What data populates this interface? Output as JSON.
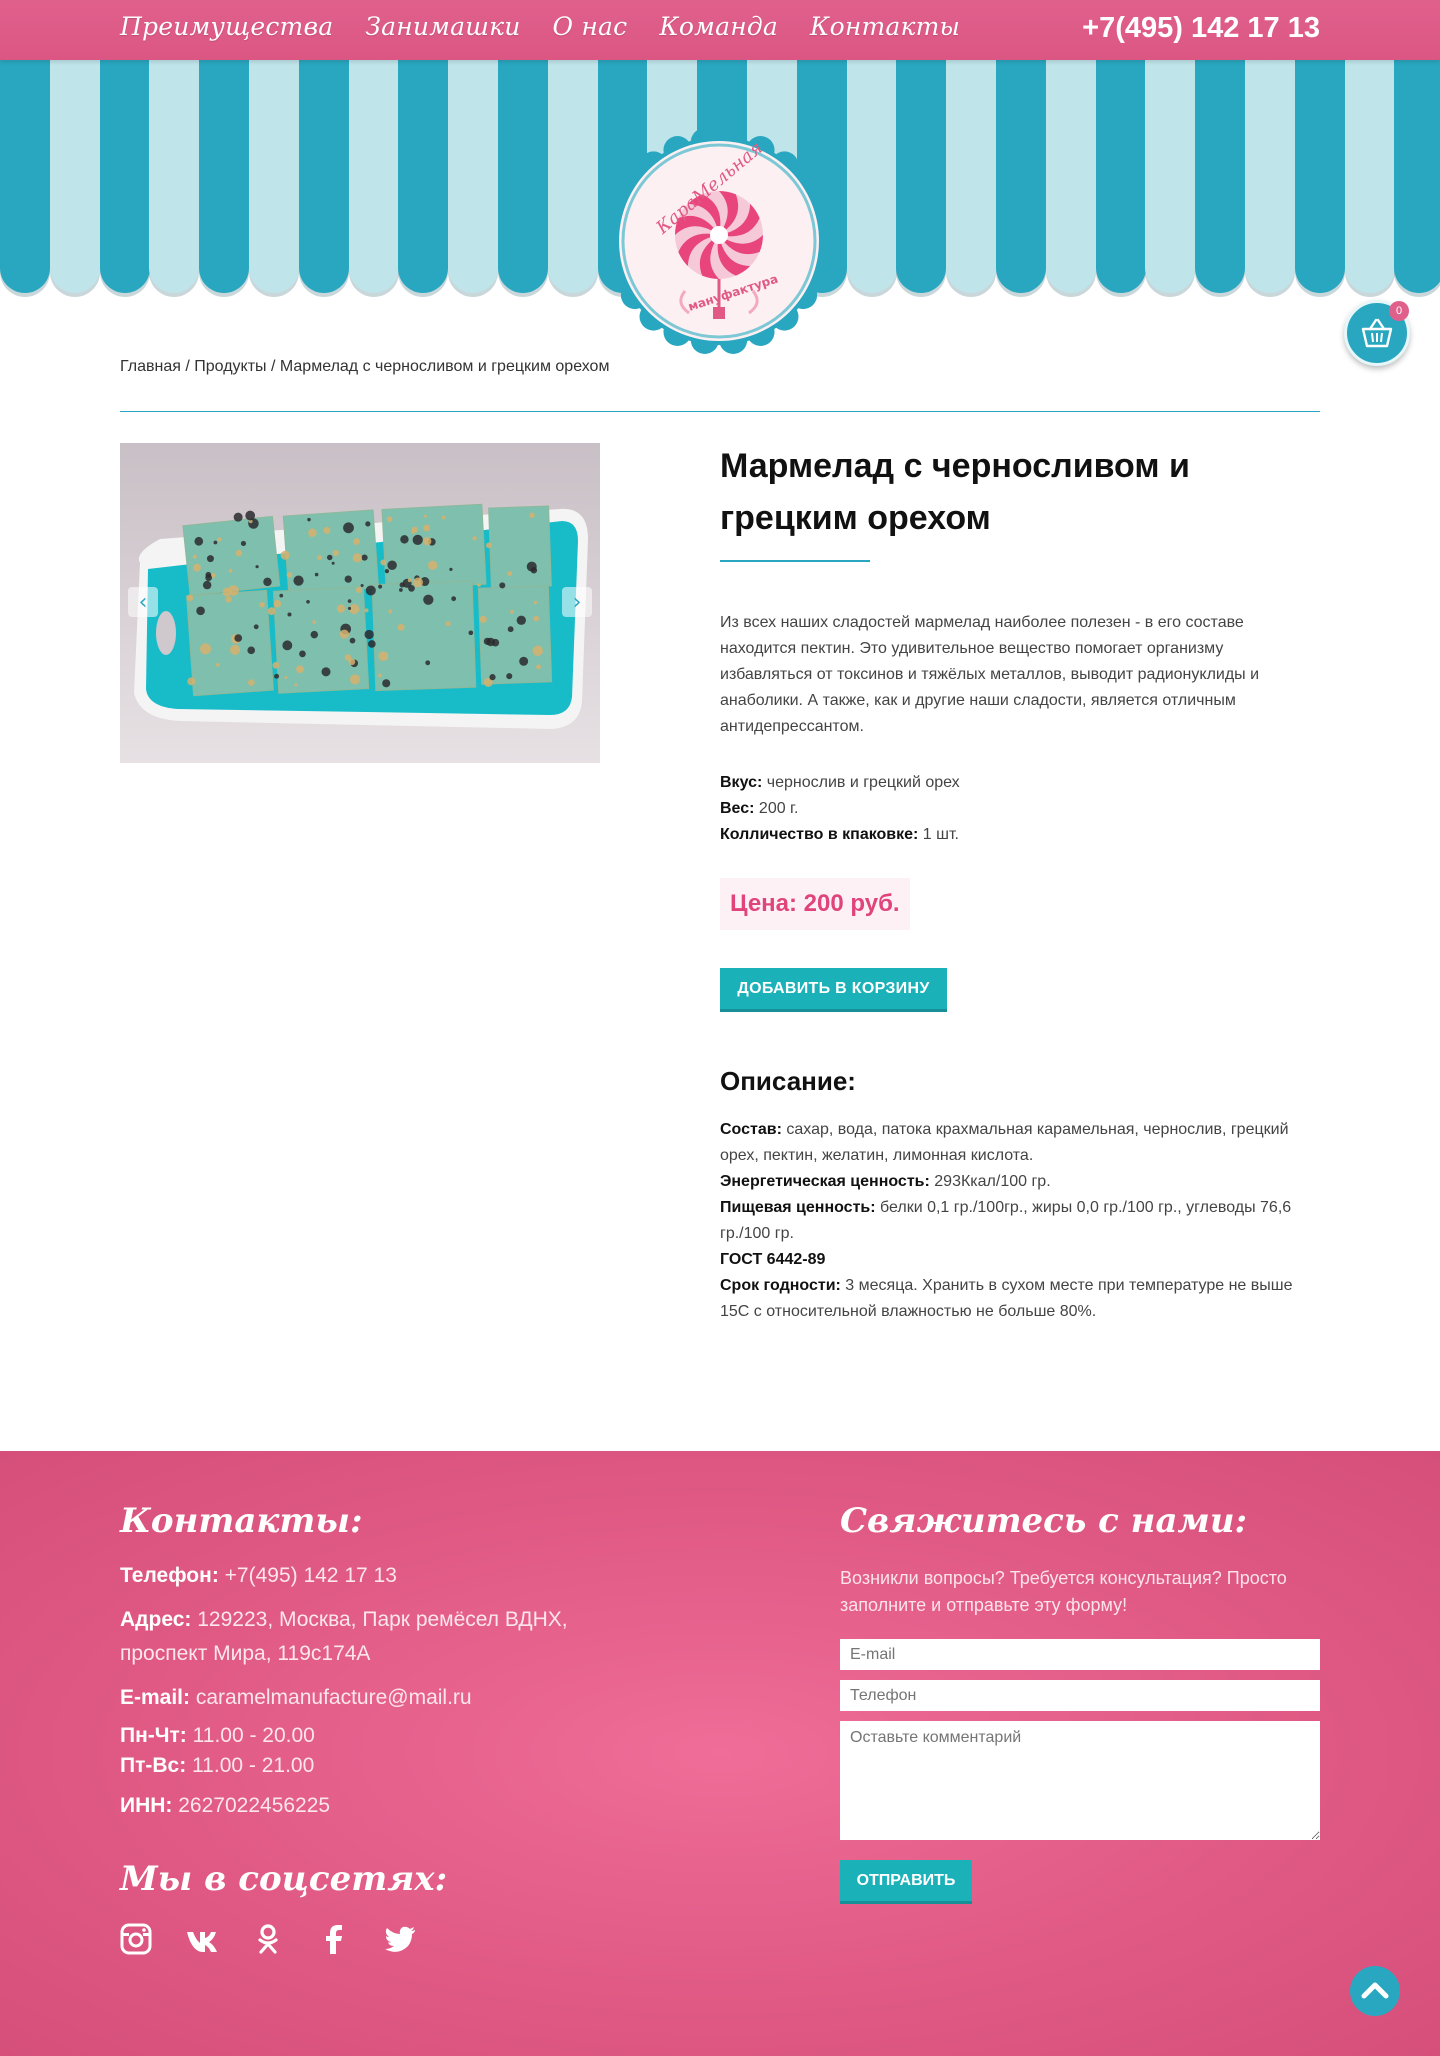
{
  "header": {
    "nav": [
      "Преимущества",
      "Занимашки",
      "О нас",
      "Команда",
      "Контакты"
    ],
    "phone": "+7(495) 142 17 13"
  },
  "logo": {
    "text_top": "КараМельная",
    "text_bottom": "мануфактура"
  },
  "cart": {
    "count": "0",
    "icon": "basket-icon"
  },
  "breadcrumb": {
    "home": "Главная",
    "sep1": " / ",
    "products": "Продукты",
    "sep2": " / ",
    "current": "Мармелад с черносливом и грецким орехом"
  },
  "product": {
    "title": "Мармелад с черносливом и грецким орехом",
    "description": "Из всех наших сладостей мармелад наиболее полезен - в его составе находится пектин. Это удивительное вещество помогает организму избавляться от токсинов и тяжёлых металлов, выводит радионуклиды и анаболики. А также, как и другие наши сладости, является отличным антидепрессантом.",
    "taste_label": "Вкус:",
    "taste_value": " чернослив и грецкий орех",
    "weight_label": "Вес:",
    "weight_value": " 200 г.",
    "qty_label": "Колличество в кпаковке:",
    "qty_value": " 1 шт.",
    "price": "Цена: 200 руб.",
    "add_to_cart": "ДОБАВИТЬ В КОРЗИНУ",
    "desc_title": "Описание:",
    "composition_label": "Состав:",
    "composition_value": " сахар, вода, патока крахмальная карамельная, чернослив, грецкий орех, пектин, желатин, лимонная кислота.",
    "energy_label": "Энергетическая ценность:",
    "energy_value": " 293Ккал/100 гр.",
    "nutrition_label": "Пищевая ценность:",
    "nutrition_value": " белки 0,1 гр./100гр., жиры 0,0 гр./100 гр., углеводы 76,6 гр./100 гр.",
    "gost": "ГОСТ 6442-89",
    "shelf_label": "Срок годности:",
    "shelf_value": " 3 месяца. Хранить в сухом месте при температуре не выше 15С с относительной влажностью не больше 80%."
  },
  "footer": {
    "contacts_title": "Контакты:",
    "phone_label": "Телефон:",
    "phone_value": " +7(495) 142 17 13",
    "address_label": "Адрес:",
    "address_value": " 129223, Москва, Парк ремёсел ВДНХ, проспект Мира, 119с174А",
    "email_label": "E-mail:",
    "email_value": " caramelmanufacture@mail.ru",
    "hours1_label": "Пн-Чт:",
    "hours1_value": " 11.00 - 20.00",
    "hours2_label": "Пт-Вс:",
    "hours2_value": " 11.00 - 21.00",
    "inn_label": "ИНН:",
    "inn_value": " 2627022456225",
    "social_title": "Мы в соцсетях:",
    "socials": [
      "instagram-icon",
      "vk-icon",
      "odnoklassniki-icon",
      "facebook-icon",
      "twitter-icon"
    ],
    "form_title": "Свяжитесь с нами:",
    "form_sub": "Возникли вопросы? Требуется консультация? Просто заполните и отправьте эту форму!",
    "email_placeholder": "E-mail",
    "phone_placeholder": "Телефон",
    "comment_placeholder": "Оставьте комментарий",
    "send": "ОТПРАВИТЬ"
  },
  "colors": {
    "pink": "#e0608c",
    "teal": "#2aa7c0",
    "light_teal": "#bfe4ea",
    "button": "#1bb1b9",
    "price": "#e0447a"
  }
}
